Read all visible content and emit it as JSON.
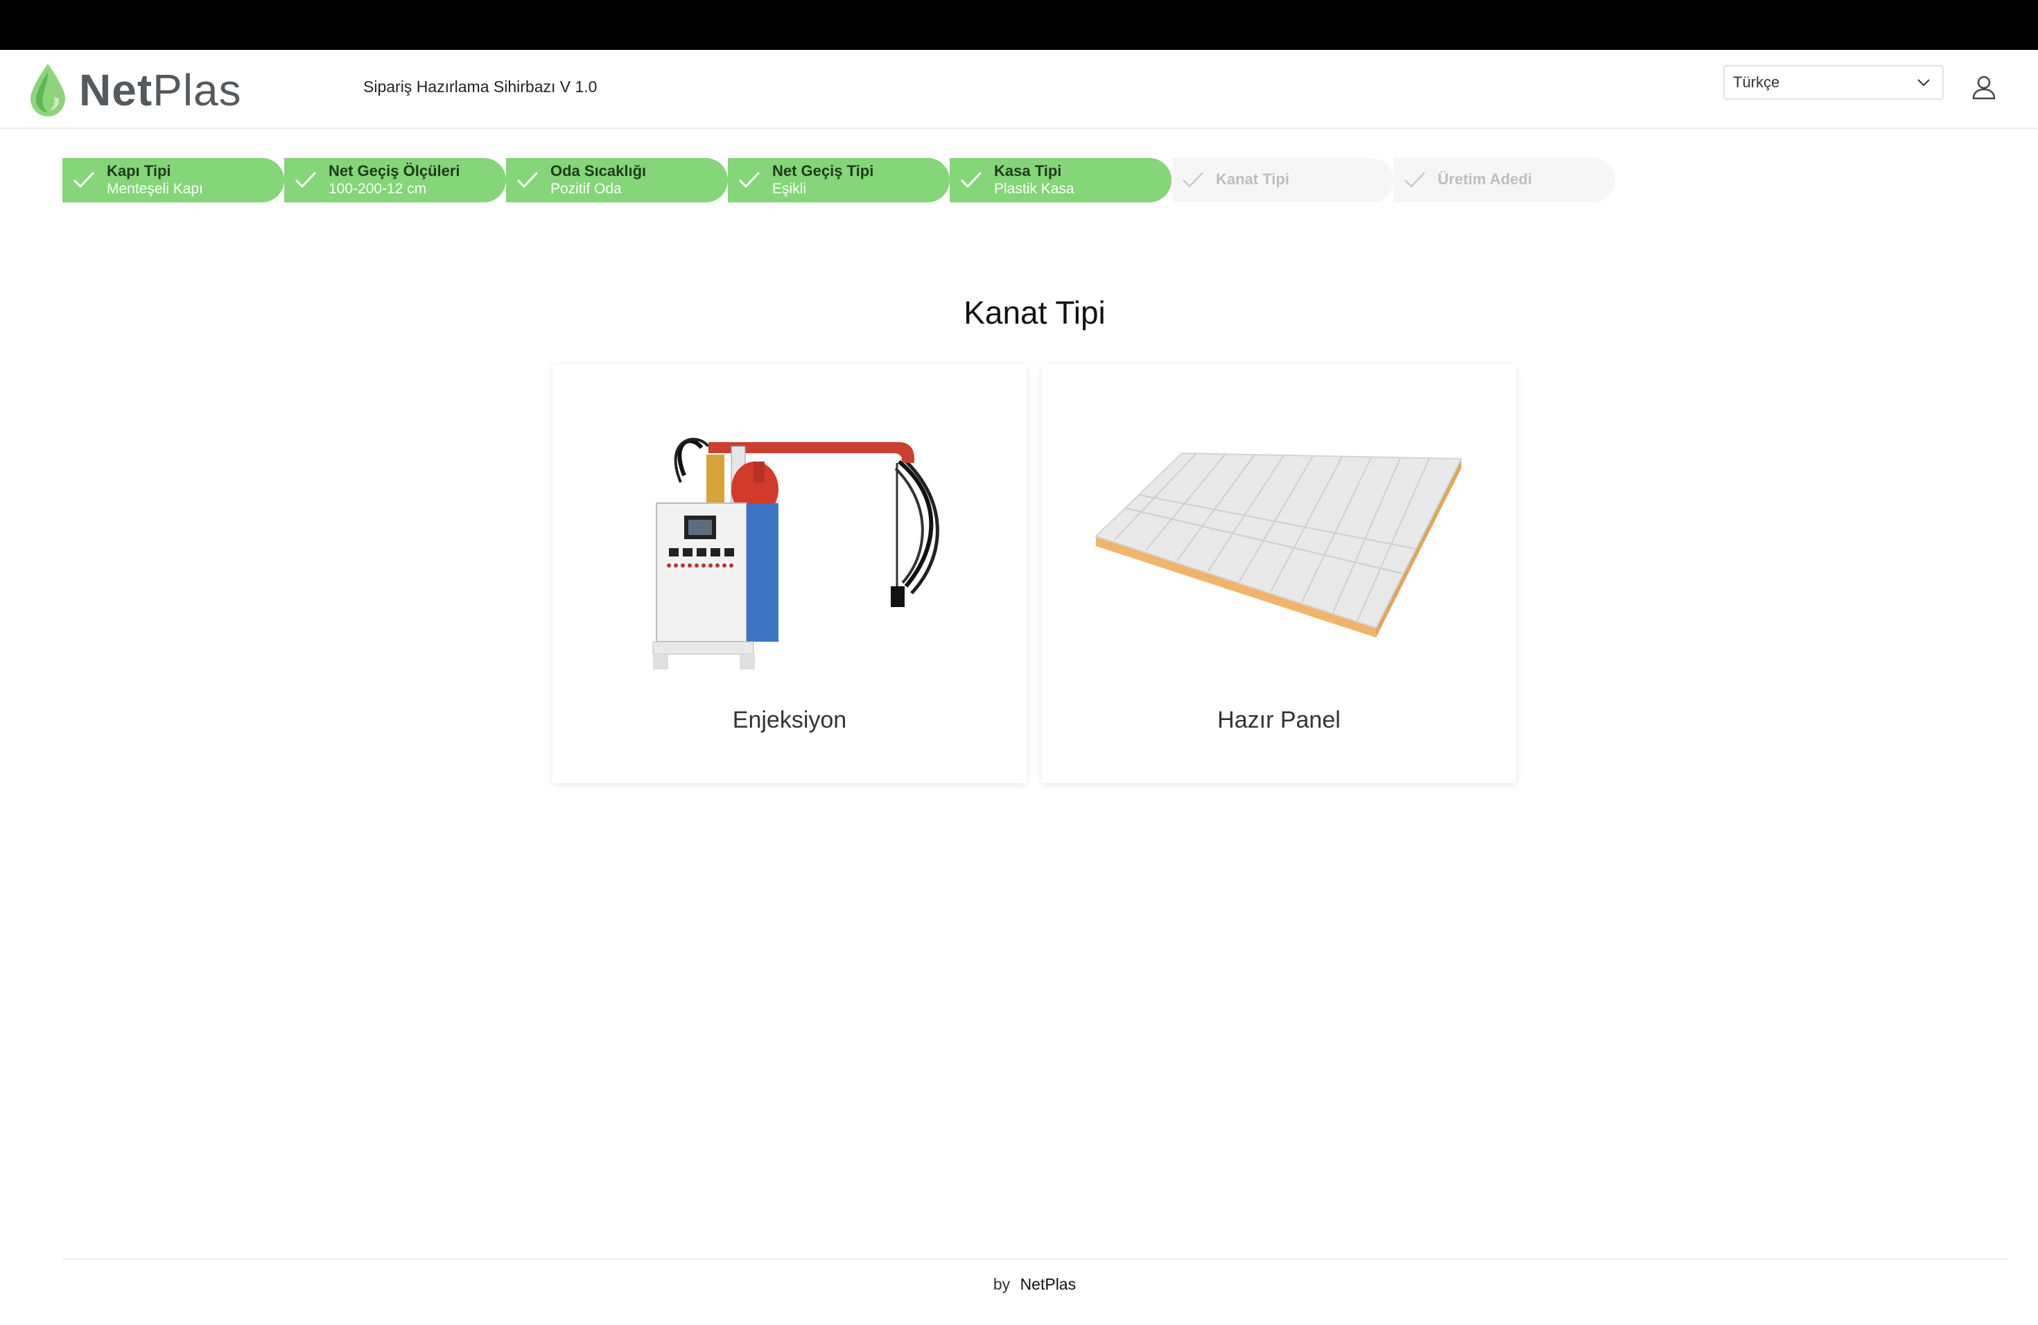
{
  "header": {
    "logo_bold": "Net",
    "logo_light": "Plas",
    "app_title": "Sipariş Hazırlama Sihirbazı V 1.0",
    "language": "Türkçe"
  },
  "steps": [
    {
      "label": "Kapı Tipi",
      "value": "Menteşeli Kapı",
      "status": "done"
    },
    {
      "label": "Net Geçiş Ölçüleri",
      "value": "100-200-12 cm",
      "status": "done"
    },
    {
      "label": "Oda Sıcaklığı",
      "value": "Pozitif Oda",
      "status": "done"
    },
    {
      "label": "Net Geçiş Tipi",
      "value": "Eşikli",
      "status": "done"
    },
    {
      "label": "Kasa Tipi",
      "value": "Plastik Kasa",
      "status": "done"
    },
    {
      "label": "Kanat Tipi",
      "value": "",
      "status": "pending"
    },
    {
      "label": "Üretim Adedi",
      "value": "",
      "status": "pending"
    }
  ],
  "main": {
    "title": "Kanat Tipi",
    "options": [
      {
        "label": "Enjeksiyon"
      },
      {
        "label": "Hazır Panel"
      }
    ]
  },
  "footer": {
    "by": "by",
    "brand": "NetPlas"
  },
  "colors": {
    "accent_green": "#85d579",
    "pending_step": "#f6f6f6"
  }
}
